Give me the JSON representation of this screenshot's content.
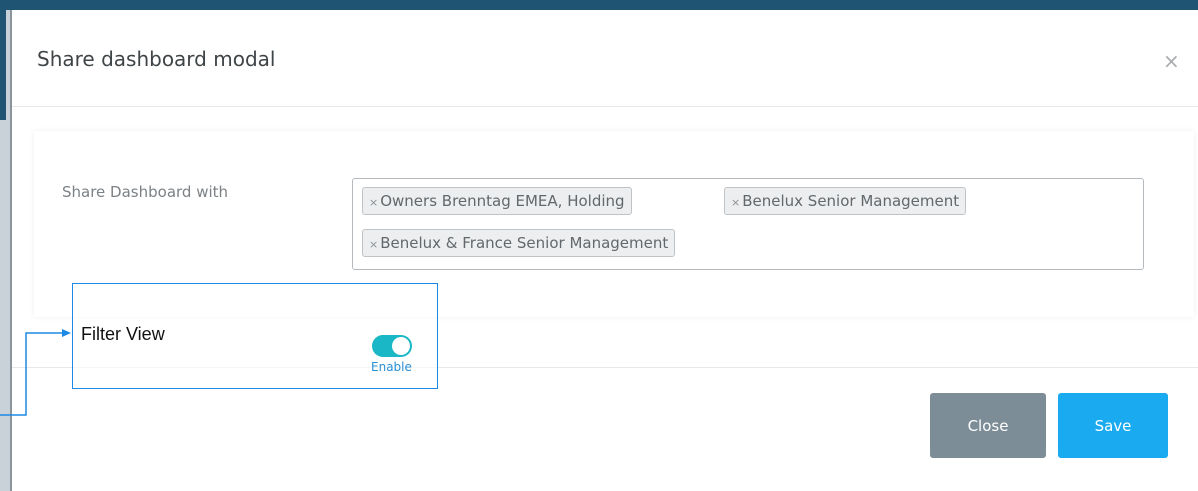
{
  "modal": {
    "title": "Share dashboard modal",
    "close_symbol": "×",
    "close_icon": "close-icon"
  },
  "share": {
    "label": "Share Dashboard with",
    "tags": [
      "Owners Brenntag EMEA, Holding",
      "Benelux Senior Management",
      "Benelux & France Senior Management"
    ],
    "remove_symbol": "×"
  },
  "filter_view": {
    "label": "Filter View",
    "toggle_state": "on",
    "toggle_label": "Enable"
  },
  "footer": {
    "close_label": "Close",
    "save_label": "Save"
  },
  "colors": {
    "accent": "#1aaaf0",
    "toggle_on": "#1ab7c6",
    "close_button": "#7d8d97",
    "header_bar": "#1f5472",
    "callout_border": "#1e88e5"
  }
}
